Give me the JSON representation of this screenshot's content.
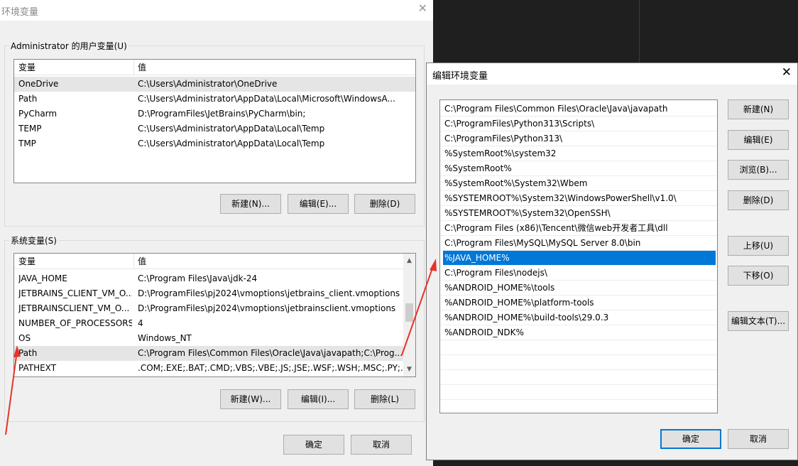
{
  "main_window": {
    "title": "环境变量",
    "user_group_label": "Administrator 的用户变量(U)",
    "system_group_label": "系统变量(S)",
    "columns": {
      "name": "变量",
      "value": "值"
    },
    "user_vars": [
      {
        "name": "OneDrive",
        "value": "C:\\Users\\Administrator\\OneDrive"
      },
      {
        "name": "Path",
        "value": "C:\\Users\\Administrator\\AppData\\Local\\Microsoft\\WindowsA..."
      },
      {
        "name": "PyCharm",
        "value": "D:\\ProgramFiles\\JetBrains\\PyCharm\\bin;"
      },
      {
        "name": "TEMP",
        "value": "C:\\Users\\Administrator\\AppData\\Local\\Temp"
      },
      {
        "name": "TMP",
        "value": "C:\\Users\\Administrator\\AppData\\Local\\Temp"
      }
    ],
    "system_vars": [
      {
        "name": "JAVA_HOME",
        "value": "C:\\Program Files\\Java\\jdk-24"
      },
      {
        "name": "JETBRAINS_CLIENT_VM_O...",
        "value": "D:\\ProgramFiles\\pj2024\\vmoptions\\jetbrains_client.vmoptions"
      },
      {
        "name": "JETBRAINSCLIENT_VM_O...",
        "value": "D:\\ProgramFiles\\pj2024\\vmoptions\\jetbrainsclient.vmoptions"
      },
      {
        "name": "NUMBER_OF_PROCESSORS",
        "value": "4"
      },
      {
        "name": "OS",
        "value": "Windows_NT"
      },
      {
        "name": "Path",
        "value": "C:\\Program Files\\Common Files\\Oracle\\Java\\javapath;C:\\Prog..."
      },
      {
        "name": "PATHEXT",
        "value": ".COM;.EXE;.BAT;.CMD;.VBS;.VBE;.JS;.JSE;.WSF;.WSH;.MSC;.PY;.P..."
      }
    ],
    "user_buttons": {
      "new": "新建(N)...",
      "edit": "编辑(E)...",
      "delete": "删除(D)"
    },
    "system_buttons": {
      "new": "新建(W)...",
      "edit": "编辑(I)...",
      "delete": "删除(L)"
    },
    "ok": "确定",
    "cancel": "取消"
  },
  "edit_dialog": {
    "title": "编辑环境变量",
    "paths": [
      "C:\\Program Files\\Common Files\\Oracle\\Java\\javapath",
      "C:\\ProgramFiles\\Python313\\Scripts\\",
      "C:\\ProgramFiles\\Python313\\",
      "%SystemRoot%\\system32",
      "%SystemRoot%",
      "%SystemRoot%\\System32\\Wbem",
      "%SYSTEMROOT%\\System32\\WindowsPowerShell\\v1.0\\",
      "%SYSTEMROOT%\\System32\\OpenSSH\\",
      "C:\\Program Files (x86)\\Tencent\\微信web开发者工具\\dll",
      "C:\\Program Files\\MySQL\\MySQL Server 8.0\\bin",
      "%JAVA_HOME%",
      "C:\\Program Files\\nodejs\\",
      "%ANDROID_HOME%\\tools",
      "%ANDROID_HOME%\\platform-tools",
      "%ANDROID_HOME%\\build-tools\\29.0.3",
      "%ANDROID_NDK%"
    ],
    "selected_path": "%JAVA_HOME%",
    "buttons": {
      "new": "新建(N)",
      "edit": "编辑(E)",
      "browse": "浏览(B)...",
      "delete": "删除(D)",
      "move_up": "上移(U)",
      "move_down": "下移(O)",
      "edit_text": "编辑文本(T)..."
    },
    "ok": "确定",
    "cancel": "取消"
  },
  "colors": {
    "selection": "#0078d7",
    "annotation": "#e8322b"
  },
  "icons": {
    "close": "close-icon",
    "scroll_up": "chevron-up-icon",
    "scroll_down": "chevron-down-icon"
  }
}
